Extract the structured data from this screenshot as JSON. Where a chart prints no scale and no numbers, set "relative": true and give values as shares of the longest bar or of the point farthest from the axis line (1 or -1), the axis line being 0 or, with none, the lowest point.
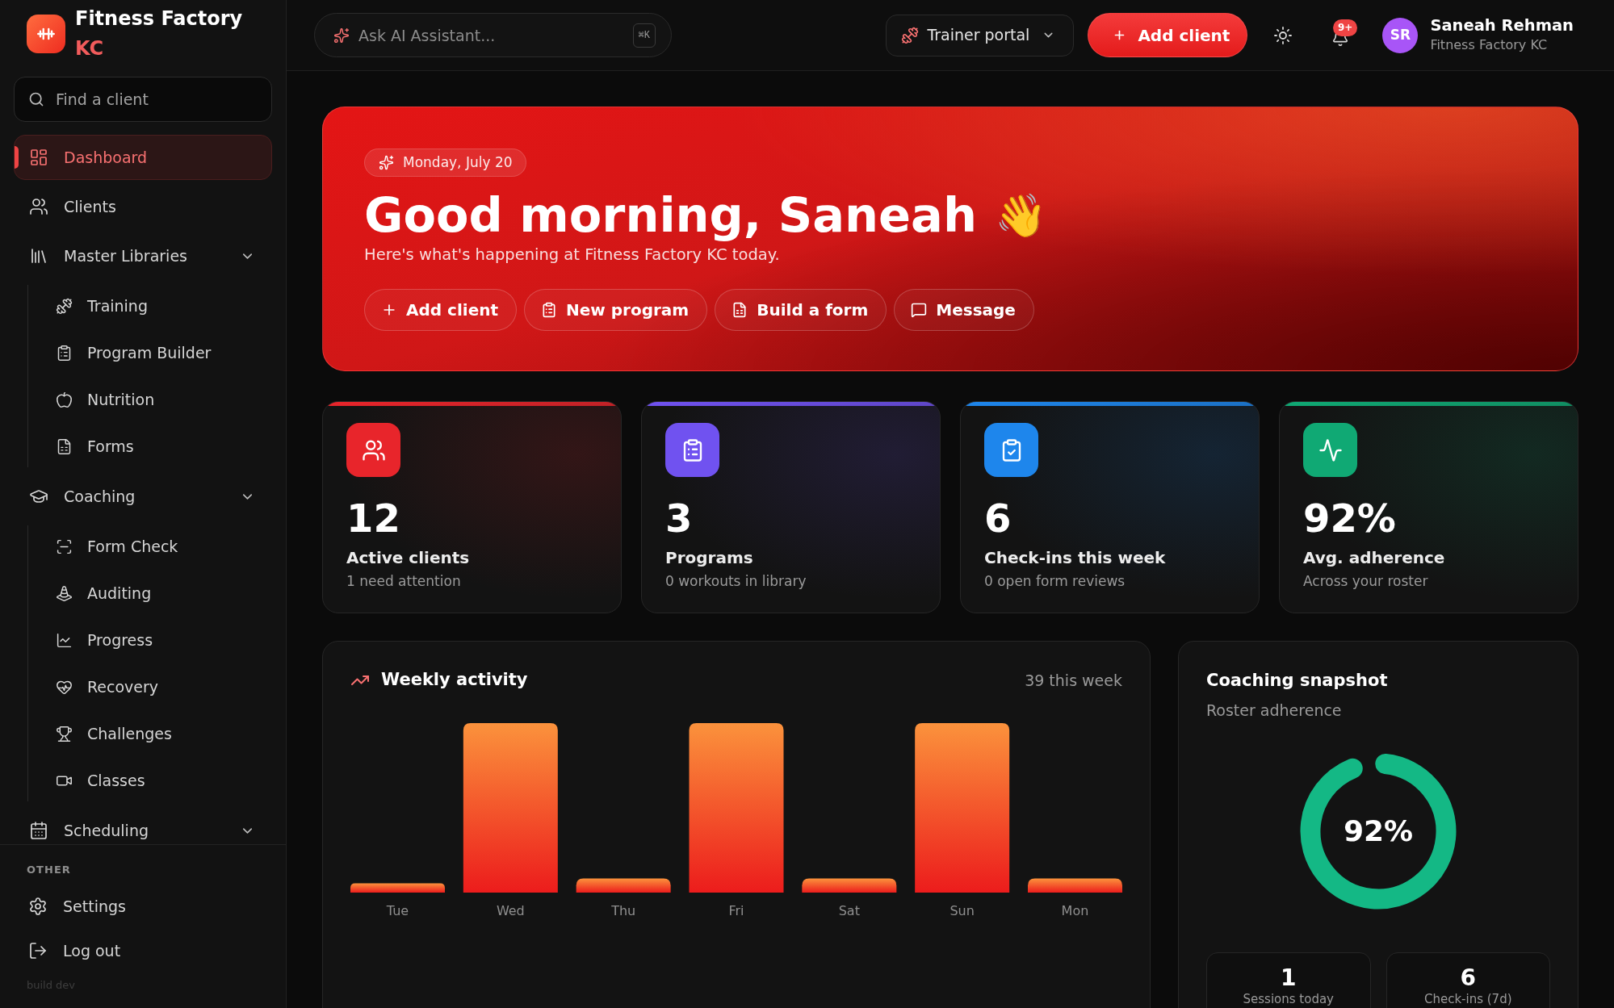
{
  "sidebar": {
    "brand": {
      "name": "Fitness Factory",
      "suffix": "KC"
    },
    "search": {
      "placeholder": "Find a client"
    },
    "nav": [
      {
        "kind": "link",
        "label": "Dashboard",
        "selected": true
      },
      {
        "kind": "link",
        "label": "Clients",
        "selected": false
      },
      {
        "kind": "group",
        "label": "Master Libraries",
        "selected": false,
        "children": [
          {
            "label": "Training",
            "selected": false
          },
          {
            "label": "Program Builder",
            "selected": false
          },
          {
            "label": "Nutrition",
            "selected": false
          },
          {
            "label": "Forms",
            "selected": false
          }
        ]
      },
      {
        "kind": "group",
        "label": "Coaching",
        "selected": false,
        "children": [
          {
            "label": "Form Check",
            "selected": false
          },
          {
            "label": "Auditing",
            "selected": false
          },
          {
            "label": "Progress",
            "selected": false
          },
          {
            "label": "Recovery",
            "selected": false
          },
          {
            "label": "Challenges",
            "selected": false
          },
          {
            "label": "Classes",
            "selected": false
          }
        ]
      },
      {
        "kind": "group",
        "label": "Scheduling",
        "selected": false
      }
    ],
    "other": {
      "heading": "OTHER",
      "items": [
        {
          "label": "Settings"
        },
        {
          "label": "Log out"
        }
      ]
    },
    "build": "build dev"
  },
  "topbar": {
    "ai_search": {
      "placeholder": "Ask AI Assistant...",
      "shortcut": "⌘K"
    },
    "portal": "Trainer portal",
    "add_button": "Add client",
    "notification_badge": "9+",
    "user": {
      "initials": "SR",
      "name": "Saneah Rehman",
      "subtitle": "Fitness Factory KC"
    }
  },
  "hero": {
    "date": "Monday, July 20",
    "greeting": "Good morning, Saneah",
    "emoji": "👋",
    "subtitle": "Here's what's happening at Fitness Factory KC today.",
    "actions": [
      "Add client",
      "New program",
      "Build a form",
      "Message"
    ]
  },
  "stats": [
    {
      "value": "12",
      "label": "Active clients",
      "note": "1 need attention",
      "color": "#e8252b"
    },
    {
      "value": "3",
      "label": "Programs",
      "note": "0 workouts in library",
      "color": "#7052f0"
    },
    {
      "value": "6",
      "label": "Check-ins this week",
      "note": "0 open form reviews",
      "color": "#1e86ec"
    },
    {
      "value": "92%",
      "label": "Avg. adherence",
      "note": "Across your roster",
      "color": "#10a974"
    }
  ],
  "weekly_activity": {
    "title": "Weekly activity",
    "total": "39 this week",
    "chart_data": {
      "type": "bar",
      "relative": true,
      "categories": [
        "Tue",
        "Wed",
        "Thu",
        "Fri",
        "Sat",
        "Sun",
        "Mon"
      ],
      "values": [
        0.055,
        1,
        0.083,
        1,
        0.083,
        1,
        0.083
      ]
    }
  },
  "coaching_snapshot": {
    "title": "Coaching snapshot",
    "subtitle": "Roster adherence",
    "level": 0.92,
    "reading": "92%",
    "tiles": [
      {
        "value": "1",
        "label": "Sessions today"
      },
      {
        "value": "6",
        "label": "Check-ins (7d)"
      }
    ]
  }
}
